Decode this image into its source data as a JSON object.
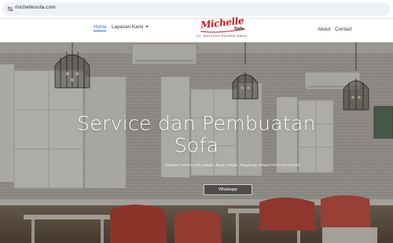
{
  "browser": {
    "url": "michellesofa.com",
    "site_icon": "tune-icon"
  },
  "navbar": {
    "home": "Home",
    "services": "Layanan Kami",
    "services_icon": "chevron-down-icon",
    "about": "About",
    "contact": "Contact",
    "active_color": "#3a6bd6"
  },
  "logo": {
    "script": "Michelle",
    "sofa": "Sofa",
    "company": "CV. ANUGRAH MAKMUR ABADI",
    "brand_color": "#d01a22"
  },
  "hero": {
    "title": "Service dan Pembuatan Sofa",
    "subtitle": "Melayani Service Sofa Jakarta, Bogor, Depok, Tangerang, Bekasi Free Antar Jemput",
    "button": "Whatsapp"
  }
}
